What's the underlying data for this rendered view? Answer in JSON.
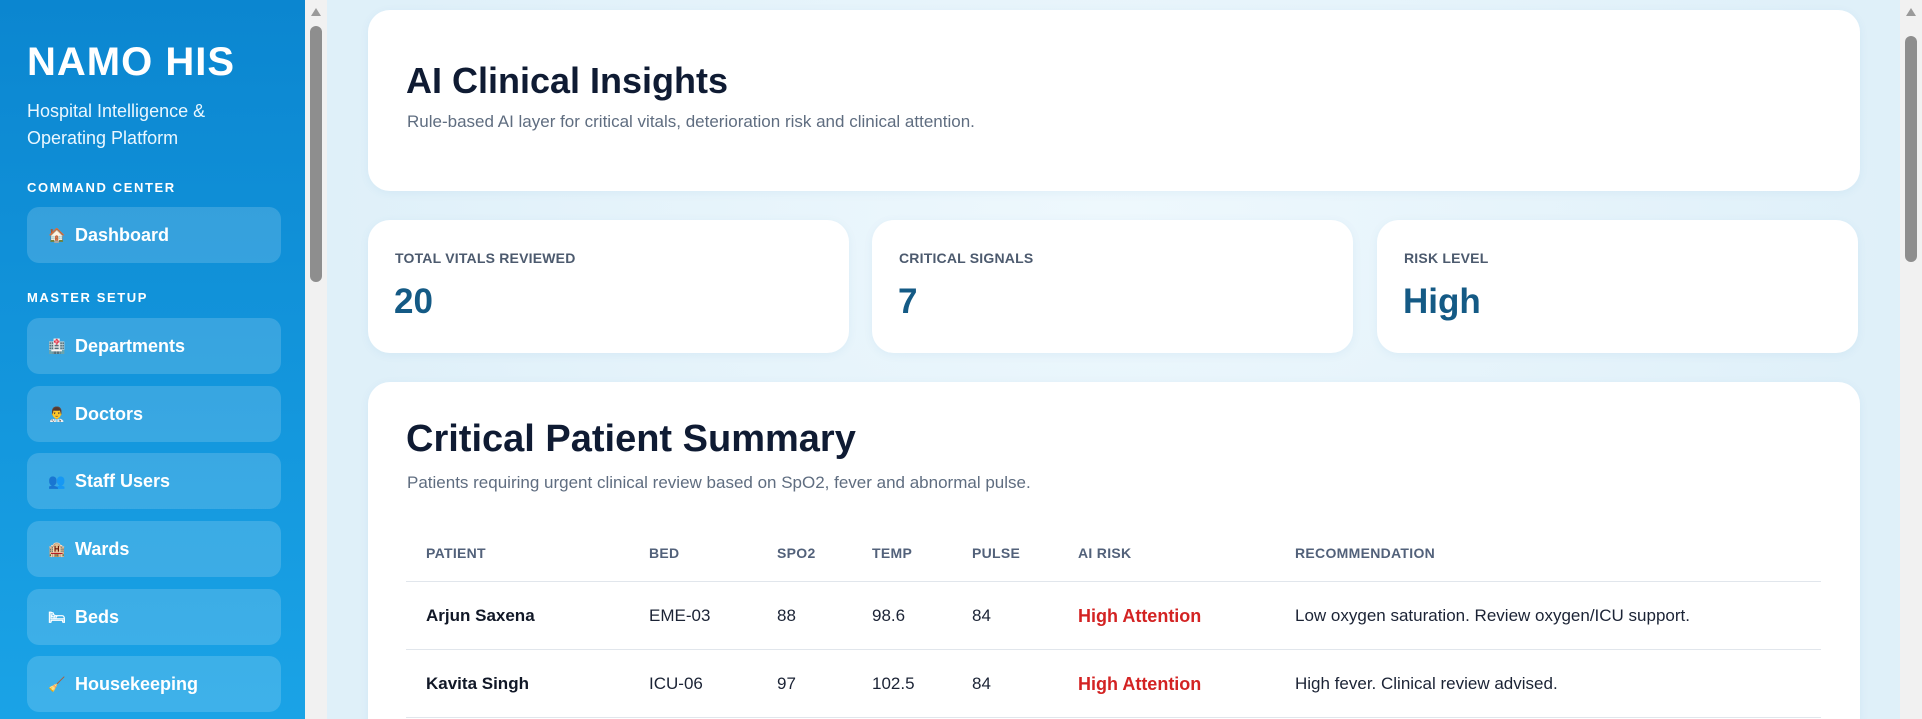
{
  "sidebar": {
    "brand": "NAMO HIS",
    "tagline": "Hospital Intelligence & Operating Platform",
    "sections": [
      {
        "label": "COMMAND CENTER"
      },
      {
        "label": "MASTER SETUP"
      }
    ],
    "items": [
      {
        "label": "Dashboard",
        "icon": "🏠",
        "icon_name": "home-icon"
      },
      {
        "label": "Departments",
        "icon": "🏥",
        "icon_name": "department-icon"
      },
      {
        "label": "Doctors",
        "icon": "👨‍⚕️",
        "icon_name": "doctor-icon"
      },
      {
        "label": "Staff Users",
        "icon": "👥",
        "icon_name": "users-icon"
      },
      {
        "label": "Wards",
        "icon": "🏨",
        "icon_name": "ward-icon"
      },
      {
        "label": "Beds",
        "icon": "🛏",
        "icon_name": "bed-icon"
      },
      {
        "label": "Housekeeping",
        "icon": "🧹",
        "icon_name": "broom-icon"
      }
    ]
  },
  "header": {
    "title": "AI Clinical Insights",
    "subtitle": "Rule-based AI layer for critical vitals, deterioration risk and clinical attention."
  },
  "stats": [
    {
      "label": "TOTAL VITALS REVIEWED",
      "value": "20"
    },
    {
      "label": "CRITICAL SIGNALS",
      "value": "7"
    },
    {
      "label": "RISK LEVEL",
      "value": "High"
    }
  ],
  "summary": {
    "title": "Critical Patient Summary",
    "subtitle": "Patients requiring urgent clinical review based on SpO2, fever and abnormal pulse.",
    "columns": [
      "PATIENT",
      "BED",
      "SPO2",
      "TEMP",
      "PULSE",
      "AI RISK",
      "RECOMMENDATION"
    ],
    "rows": [
      [
        "Arjun Saxena",
        "EME-03",
        "88",
        "98.6",
        "84",
        "High Attention",
        "Low oxygen saturation. Review oxygen/ICU support."
      ],
      [
        "Kavita Singh",
        "ICU-06",
        "97",
        "102.5",
        "84",
        "High Attention",
        "High fever. Clinical review advised."
      ]
    ]
  },
  "colors": {
    "sidebar_top": "#0b86d0",
    "sidebar_bottom": "#1aa3e6",
    "stat_value": "#145a85",
    "risk_red": "#d32323",
    "heading": "#0f1b33"
  }
}
